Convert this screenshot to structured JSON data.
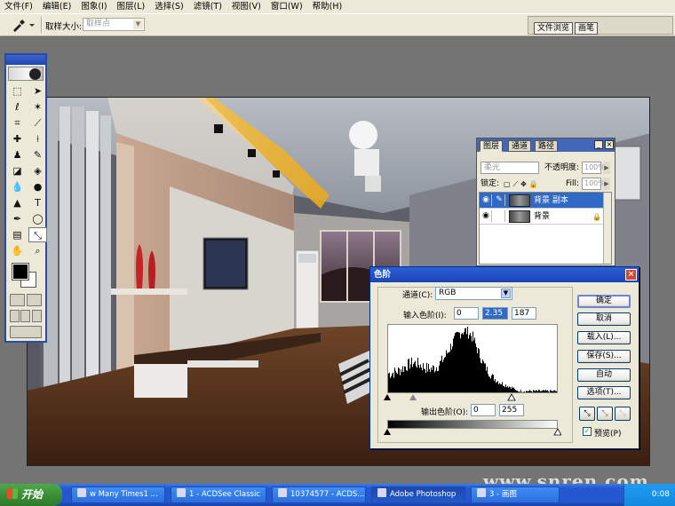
{
  "menu": [
    "文件(F)",
    "编辑(E)",
    "图象(I)",
    "图层(L)",
    "选择(S)",
    "滤镜(T)",
    "视图(V)",
    "窗口(W)",
    "帮助(H)"
  ],
  "options": {
    "tool_icon": "eyedropper-icon",
    "sample_size_label": "取样大小:",
    "sample_size_value": "取样点"
  },
  "palette_well": {
    "tabs": [
      "文件浏览",
      "画笔"
    ]
  },
  "toolbox": {
    "tools": [
      "rect-marquee-icon",
      "move-icon",
      "lasso-icon",
      "magic-wand-icon",
      "crop-icon",
      "slice-icon",
      "healing-brush-icon",
      "brush-icon",
      "stamp-icon",
      "history-brush-icon",
      "eraser-icon",
      "paint-bucket-icon",
      "blur-icon",
      "dodge-icon",
      "path-select-icon",
      "type-icon",
      "pen-icon",
      "shape-icon",
      "notes-icon",
      "eyedropper-icon",
      "hand-icon",
      "zoom-icon"
    ],
    "colors": {
      "foreground": "#000000",
      "background": "#ffffff"
    }
  },
  "layers_panel": {
    "tabs": [
      "图层",
      "通道",
      "路径"
    ],
    "blend_mode": "柔光",
    "opacity_label": "不透明度:",
    "opacity_value": "100%",
    "lock_label": "锁定:",
    "fill_label": "Fill:",
    "fill_value": "100%",
    "layers": [
      {
        "name": "背景 副本",
        "selected": true
      },
      {
        "name": "背景",
        "selected": false
      }
    ]
  },
  "levels_dialog": {
    "title": "色阶",
    "channel_label": "通道(C):",
    "channel_value": "RGB",
    "input_label": "输入色阶(I):",
    "input_values": [
      "0",
      "2.35",
      "187"
    ],
    "output_label": "输出色阶(O):",
    "output_values": [
      "0",
      "255"
    ],
    "buttons": [
      "确定",
      "取消",
      "载入(L)...",
      "保存(S)...",
      "自动",
      "选项(T)..."
    ],
    "preview_label": "预览(P)",
    "preview_checked": true
  },
  "taskbar": {
    "start_label": "开始",
    "tasks": [
      {
        "label": "w Many Times1 ...",
        "active": false
      },
      {
        "label": "1 - ACDSee Classic",
        "active": false
      },
      {
        "label": "10374577 - ACDS...",
        "active": false
      },
      {
        "label": "Adobe Photoshop",
        "active": true
      },
      {
        "label": "3 - 画图",
        "active": false
      }
    ],
    "clock": "0:08"
  },
  "watermark": "www.snren.com",
  "accent_colors": {
    "titlebar": "#2c5fd8",
    "taskbar": "#2457d0",
    "selection": "#316ac5"
  }
}
